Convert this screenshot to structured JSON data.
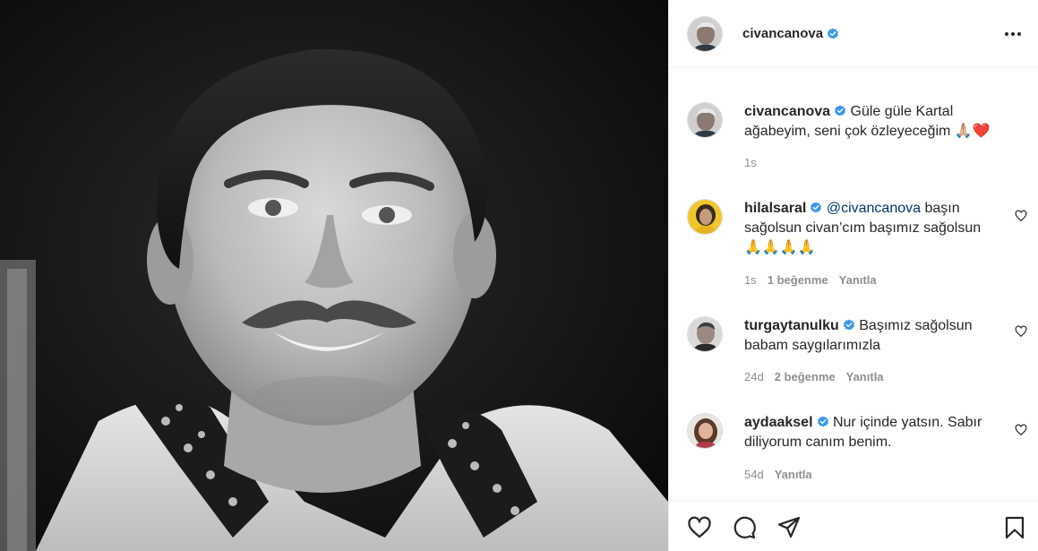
{
  "post": {
    "author": "civancanova",
    "photo_alt": "black-and-white portrait photo"
  },
  "caption": {
    "username": "civancanova",
    "text": "Güle güle Kartal ağabeyim, seni çok özleyeceğim 🙏🏼❤️",
    "time": "1s"
  },
  "comments": [
    {
      "username": "hilalsaral",
      "mention": "@civancanova",
      "text": " başın sağolsun civan’cım başımız sağolsun 🙏🙏🙏🙏",
      "time": "1s",
      "likes": "1 beğenme",
      "reply": "Yanıtla"
    },
    {
      "username": "turgaytanulku",
      "mention": "",
      "text": " Başımız sağolsun babam saygılarımızla",
      "time": "24d",
      "likes": "2 beğenme",
      "reply": "Yanıtla"
    },
    {
      "username": "aydaaksel",
      "mention": "",
      "text": " Nur içinde yatsın. Sabır diliyorum canım benim.",
      "time": "54d",
      "likes": "",
      "reply": "Yanıtla"
    }
  ],
  "icons": {
    "like": "heart-icon",
    "comment": "comment-icon",
    "share": "share-icon",
    "save": "bookmark-icon",
    "more": "more-icon",
    "verified": "verified-badge-icon"
  },
  "colors": {
    "verified": "#3897f0",
    "heart_emoji": "#ed2e3c",
    "meta": "#8e8e8e",
    "link": "#00376b"
  }
}
